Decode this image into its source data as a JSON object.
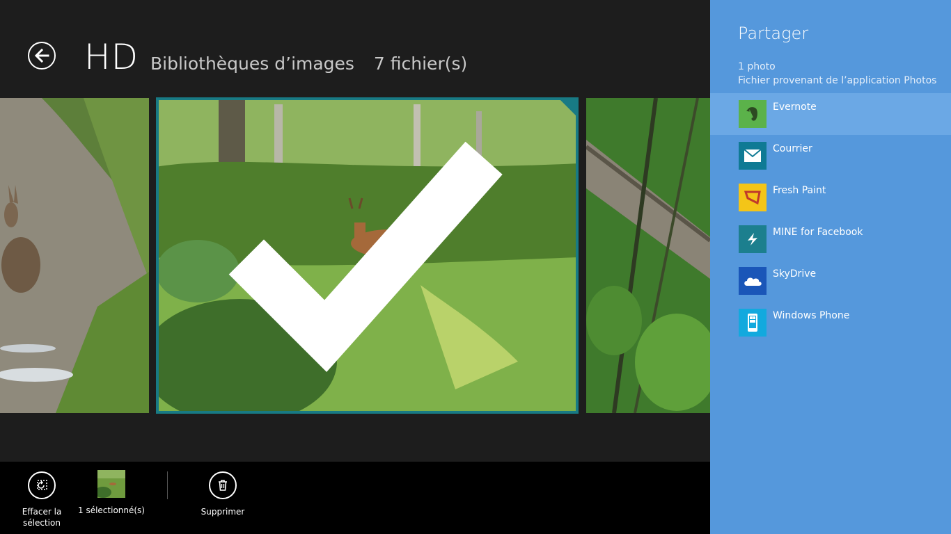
{
  "header": {
    "title": "HD",
    "library": "Bibliothèques d’images",
    "file_count": "7 fichier(s)"
  },
  "appbar": {
    "clear_selection_label": "Effacer la sélection",
    "selected_count_label": "1 sélectionné(s)",
    "delete_label": "Supprimer"
  },
  "share": {
    "title": "Partager",
    "info_line1": "1 photo",
    "info_line2": "Fichier provenant de l’application Photos",
    "targets": [
      {
        "label": "Evernote",
        "icon": "evernote-icon",
        "color": "#5bb24a"
      },
      {
        "label": "Courrier",
        "icon": "mail-icon",
        "color": "#0f7a94"
      },
      {
        "label": "Fresh Paint",
        "icon": "fresh-paint-icon",
        "color": "#f4c518"
      },
      {
        "label": "MINE for Facebook",
        "icon": "mine-facebook-icon",
        "color": "#1c7f8e"
      },
      {
        "label": "SkyDrive",
        "icon": "skydrive-icon",
        "color": "#1a56b8"
      },
      {
        "label": "Windows Phone",
        "icon": "windows-phone-icon",
        "color": "#12a9de"
      }
    ]
  },
  "colors": {
    "background": "#1d1d1d",
    "selection_accent": "#187a84",
    "share_pane": "#5598dc",
    "share_selected": "#6ba8e5"
  }
}
